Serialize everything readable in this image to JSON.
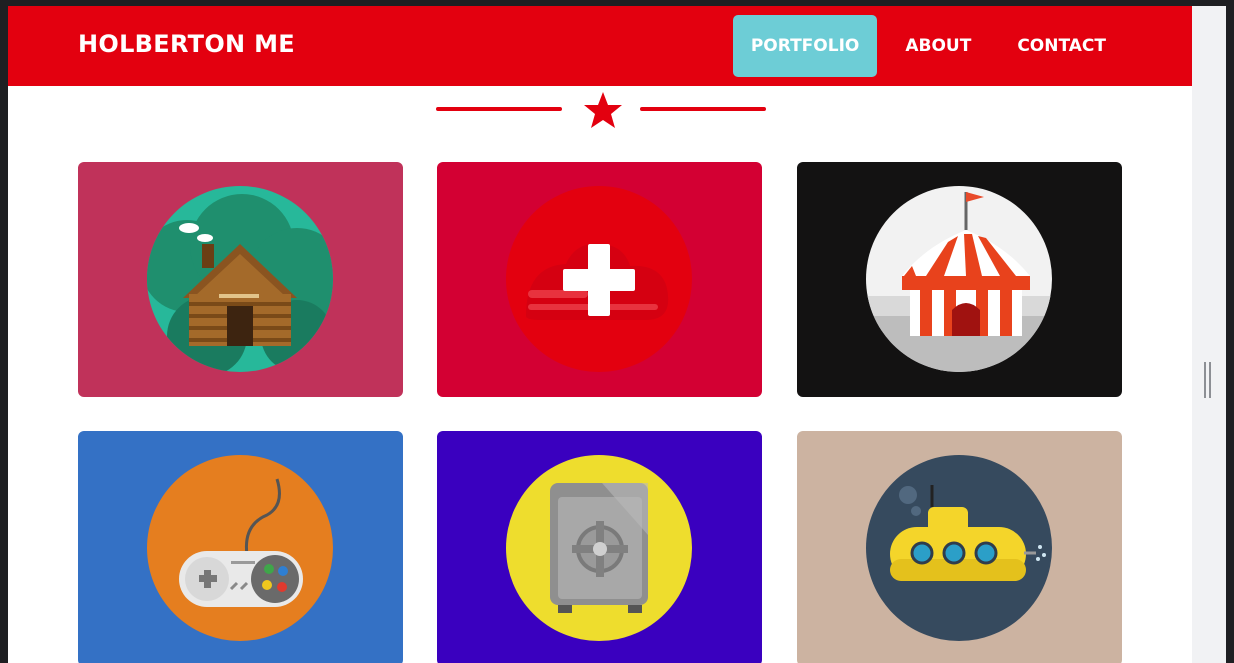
{
  "header": {
    "brand": "HOLBERTON ME",
    "nav": [
      {
        "label": "PORTFOLIO",
        "active": true
      },
      {
        "label": "ABOUT",
        "active": false
      },
      {
        "label": "CONTACT",
        "active": false
      }
    ]
  },
  "colors": {
    "brand_red": "#e3000f",
    "active_tab": "#6dcdd6",
    "background": "#ffffff"
  },
  "divider": {
    "icon": "star-icon"
  },
  "portfolio": [
    {
      "icon": "log-cabin-icon",
      "tile_color": "#c0325a",
      "disc_color": "#27b89a"
    },
    {
      "icon": "plus-icon",
      "tile_color": "#d30033",
      "disc_color": "#e3000f"
    },
    {
      "icon": "circus-tent-icon",
      "tile_color": "#131212",
      "disc_color": "#f2f2f2"
    },
    {
      "icon": "game-controller-icon",
      "tile_color": "#3471c5",
      "disc_color": "#e57e1f"
    },
    {
      "icon": "safe-icon",
      "tile_color": "#3a00bf",
      "disc_color": "#eedd2d"
    },
    {
      "icon": "submarine-icon",
      "tile_color": "#ccb3a1",
      "disc_color": "#364a5e"
    }
  ]
}
